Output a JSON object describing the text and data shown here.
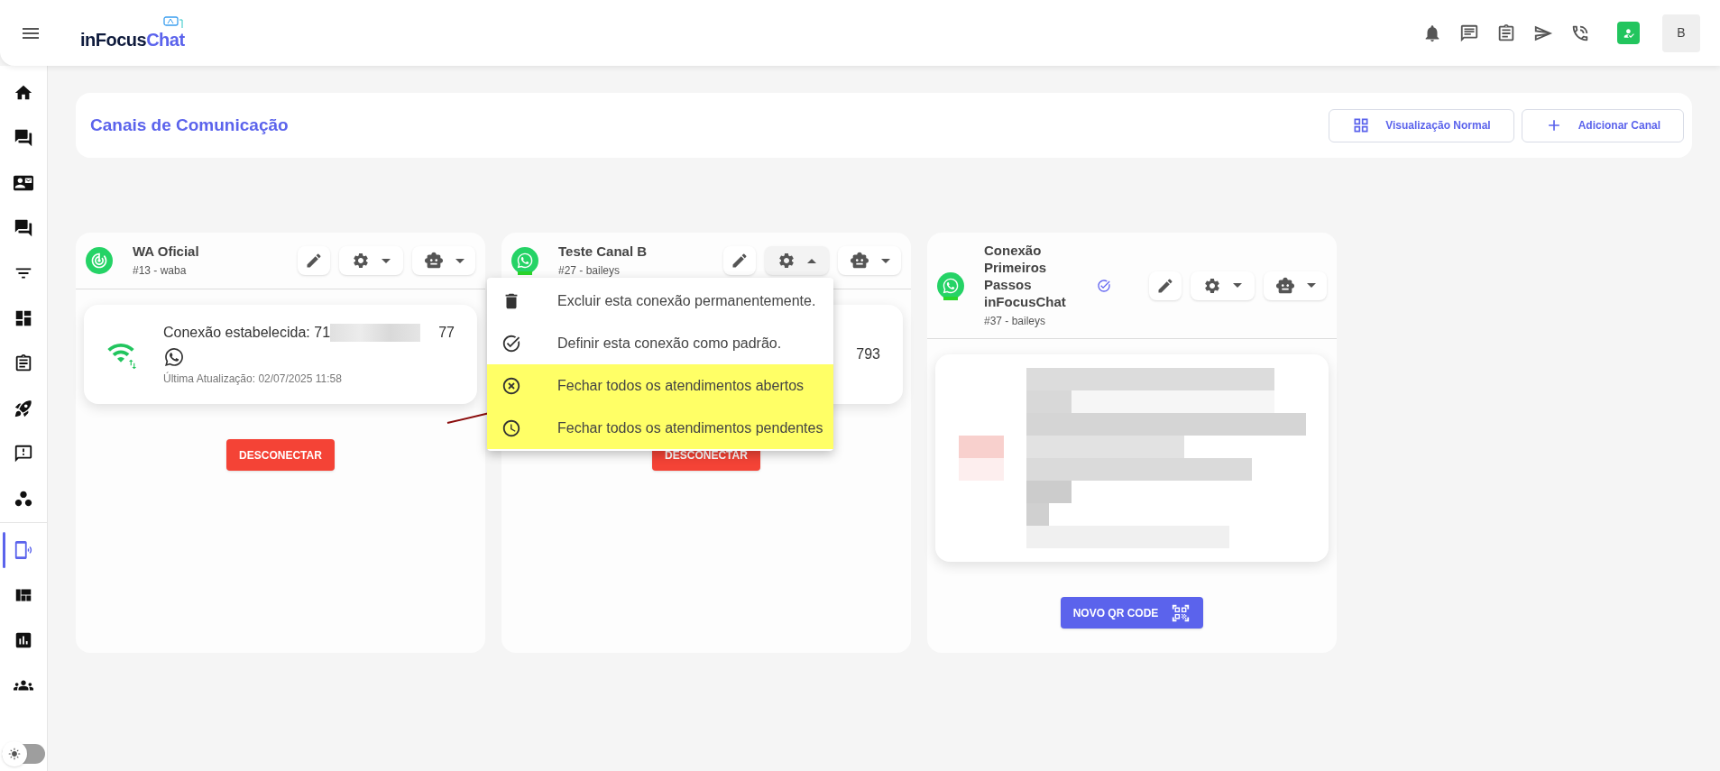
{
  "topbar": {
    "logo": [
      "inFocus",
      "Chat"
    ],
    "avatar": "B"
  },
  "sidebar": {
    "items": [
      {
        "kind": "home",
        "selected": false
      },
      {
        "kind": "forum",
        "selected": false
      },
      {
        "kind": "contact",
        "selected": false
      },
      {
        "kind": "chat",
        "selected": false
      },
      {
        "kind": "filter",
        "selected": false
      },
      {
        "kind": "board",
        "selected": false
      },
      {
        "kind": "clipboard",
        "selected": false
      },
      {
        "kind": "rocket",
        "selected": false
      },
      {
        "kind": "bookmark",
        "selected": false
      },
      {
        "kind": "hex",
        "selected": false
      },
      {
        "kind": "channels",
        "selected": true
      },
      {
        "kind": "quilt",
        "selected": false
      },
      {
        "kind": "report",
        "selected": false
      },
      {
        "kind": "groups",
        "selected": false
      }
    ],
    "theme_toggle": {
      "on": false
    }
  },
  "header": {
    "title": "Canais de Comunicação",
    "buttons": [
      {
        "kind": "grid",
        "label": "Visualização Normal"
      },
      {
        "kind": "add",
        "label": "Adicionar Canal"
      }
    ]
  },
  "channels": [
    {
      "name": "WA Oficial",
      "subtitle": "#13 - waba",
      "kind": "ring",
      "default": false,
      "settings_expanded": false,
      "status": {
        "kind": "connected",
        "text_start": "Conexão estabelecida: 71",
        "text_end": "77",
        "updated": "Última Atualização: 02/07/2025 11:58"
      },
      "action": {
        "kind": "disconnect",
        "label": "DESCONECTAR"
      }
    },
    {
      "name": "Teste Canal B",
      "subtitle": "#27 - baileys",
      "kind": "whatsapp",
      "default": false,
      "settings_expanded": true,
      "status": {
        "kind": "connected",
        "text_end": "793"
      },
      "action": {
        "kind": "disconnect",
        "label": "DESCONECTAR"
      },
      "menu": [
        {
          "kind": "delete",
          "label": "Excluir esta conexão permanentemente.",
          "highlighted": false
        },
        {
          "kind": "check",
          "label": "Definir esta conexão como padrão.",
          "highlighted": false
        },
        {
          "kind": "close-open",
          "label": "Fechar todos os atendimentos abertos",
          "highlighted": true
        },
        {
          "kind": "close-pending",
          "label": "Fechar todos os atendimentos pendentes",
          "highlighted": true
        }
      ]
    },
    {
      "name": "Conexão Primeiros Passos inFocusChat",
      "subtitle": "#37 - baileys",
      "kind": "whatsapp",
      "default": true,
      "settings_expanded": false,
      "status": {
        "kind": "qr"
      },
      "action": {
        "kind": "qr",
        "label": "NOVO QR CODE"
      }
    }
  ]
}
